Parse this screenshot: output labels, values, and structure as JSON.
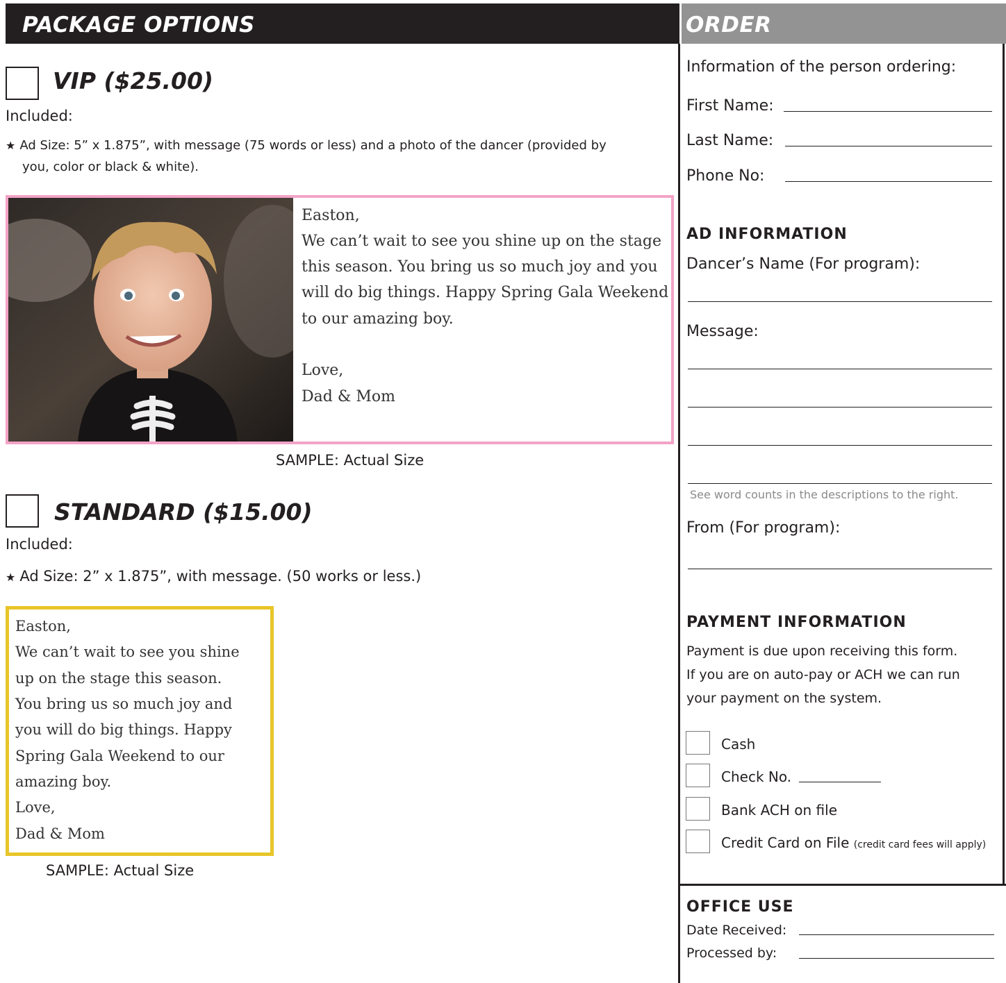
{
  "left": {
    "header": "Package Options",
    "vip": {
      "title": "VIP ($25.00)",
      "included_label": "Included:",
      "bullet_line1": "Ad Size: 5” x 1.875”, with message (75 words or less) and a photo of the dancer (provided by",
      "bullet_line2": "you, color or black & white).",
      "sample": {
        "greeting": "Easton,",
        "lines": [
          "We can’t wait to see you shine up on the stage",
          "this season. You bring us so much joy and you",
          "will do big things. Happy Spring Gala Weekend",
          "to our amazing boy."
        ],
        "closing": "Love,",
        "signature": "Dad & Mom"
      },
      "caption": "SAMPLE: Actual Size"
    },
    "standard": {
      "title": "Standard ($15.00)",
      "included_label": "Included:",
      "bullet": "Ad Size: 2” x 1.875”, with message. (50 works or less.)",
      "sample": {
        "lines": [
          "Easton,",
          "We can’t wait to see you shine",
          "up on the stage this season.",
          "You bring us so much joy and",
          "you will do big things. Happy",
          "Spring Gala Weekend to our",
          "amazing boy.",
          "Love,",
          "Dad & Mom"
        ]
      },
      "caption": "SAMPLE: Actual Size"
    }
  },
  "right": {
    "header": "Order",
    "intro": "Information of the person ordering:",
    "first_name": "First Name:",
    "last_name": "Last Name:",
    "phone": "Phone No:",
    "ad_info": {
      "heading": "AD INFORMATION",
      "dancer_name": "Dancer’s Name (For program):",
      "message": "Message:",
      "hint": "See word counts in the descriptions to the right.",
      "from": "From (For program):"
    },
    "payment": {
      "heading": "PAYMENT INFORMATION",
      "line1": "Payment is due upon receiving this form.",
      "line2": "If you are on auto-pay or ACH we can run",
      "line3": "your payment on the system.",
      "options": [
        "Cash",
        "Check No.",
        "Bank ACH on file",
        "Credit Card on File"
      ],
      "cc_note": "(credit card fees will apply)"
    },
    "office": {
      "heading": "OFFICE USE",
      "date_received": "Date Received:",
      "processed_by": "Processed by:"
    }
  }
}
